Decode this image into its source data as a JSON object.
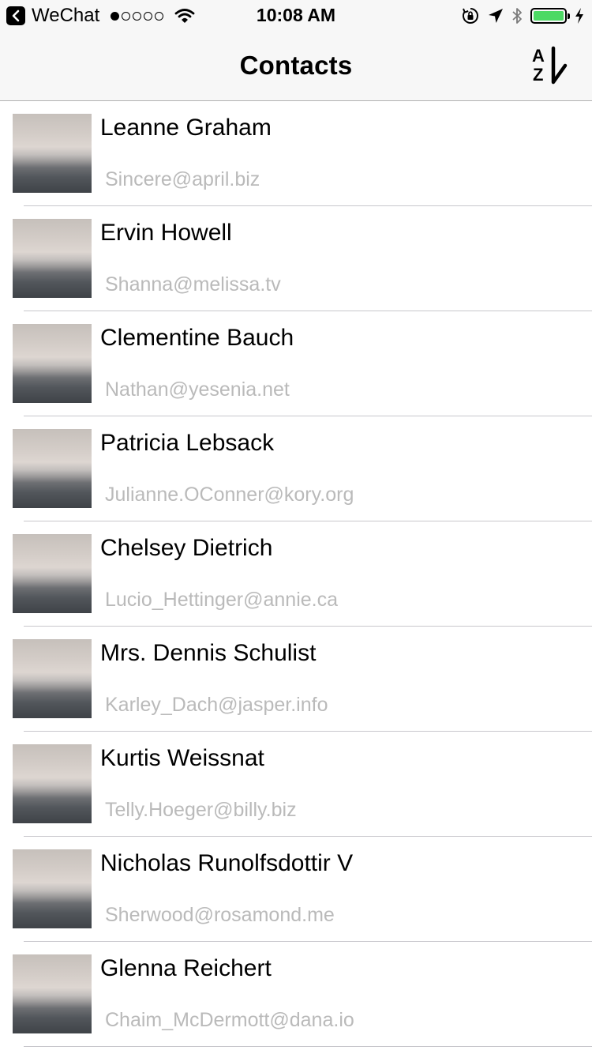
{
  "status_bar": {
    "back_app": "WeChat",
    "time": "10:08 AM",
    "signal_bars": 1,
    "signal_total": 5,
    "battery_level": 1.0,
    "battery_color": "#4cd964"
  },
  "nav": {
    "title": "Contacts",
    "sort_icon": "sort-alpha-down-icon",
    "sort_top_letter": "A",
    "sort_bottom_letter": "Z"
  },
  "contacts": [
    {
      "name": "Leanne Graham",
      "email": "Sincere@april.biz"
    },
    {
      "name": "Ervin Howell",
      "email": "Shanna@melissa.tv"
    },
    {
      "name": "Clementine Bauch",
      "email": "Nathan@yesenia.net"
    },
    {
      "name": "Patricia Lebsack",
      "email": "Julianne.OConner@kory.org"
    },
    {
      "name": "Chelsey Dietrich",
      "email": "Lucio_Hettinger@annie.ca"
    },
    {
      "name": "Mrs. Dennis Schulist",
      "email": "Karley_Dach@jasper.info"
    },
    {
      "name": "Kurtis Weissnat",
      "email": "Telly.Hoeger@billy.biz"
    },
    {
      "name": "Nicholas Runolfsdottir V",
      "email": "Sherwood@rosamond.me"
    },
    {
      "name": "Glenna Reichert",
      "email": "Chaim_McDermott@dana.io"
    }
  ]
}
